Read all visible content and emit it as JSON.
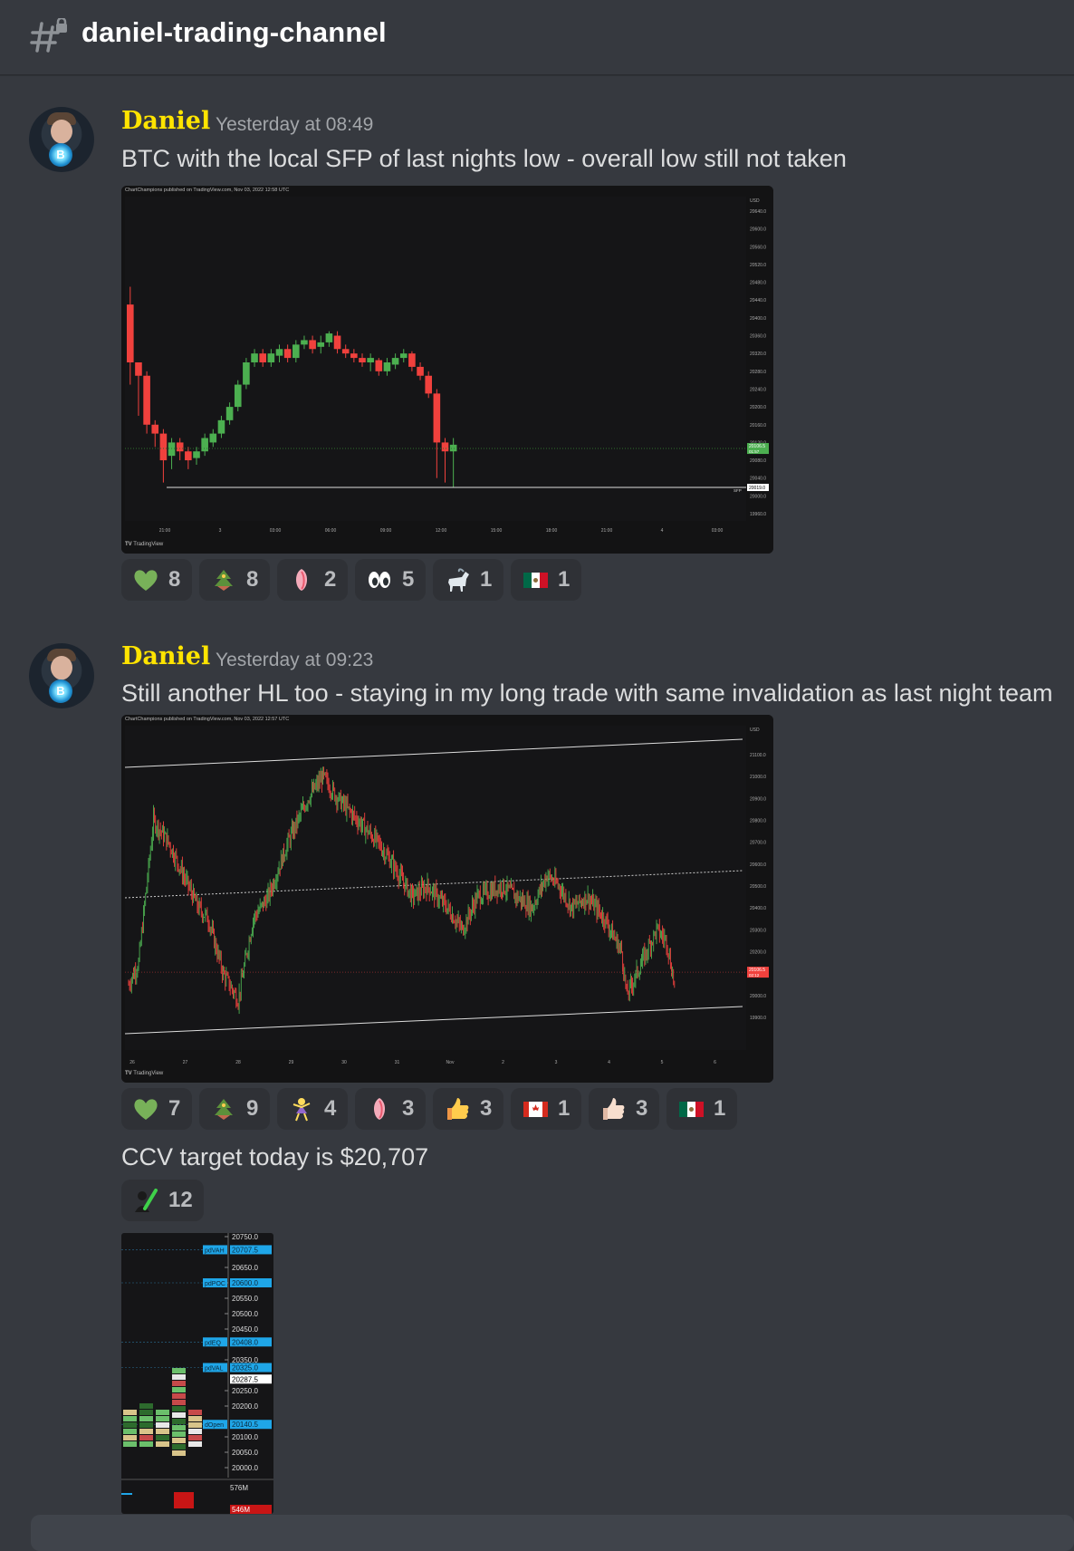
{
  "channel": {
    "name": "daniel-trading-channel",
    "icon": "locked-hash-icon"
  },
  "messages": [
    {
      "author": "Daniel",
      "timestamp": "Yesterday at 08:49",
      "text": "BTC with the local SFP of last nights low - overall low still not taken",
      "chart": {
        "attribution": "ChartChampions published on TradingView.com, Nov 03, 2022 12:58 UTC",
        "brand": "TradingView",
        "currency": "USD",
        "x_ticks": [
          "21:00",
          "3",
          "03:00",
          "06:00",
          "09:00",
          "12:00",
          "15:00",
          "18:00",
          "21:00",
          "4",
          "03:00"
        ],
        "y_ticks": [
          "20640.0",
          "20600.0",
          "20560.0",
          "20520.0",
          "20480.0",
          "20440.0",
          "20400.0",
          "20360.0",
          "20320.0",
          "20280.0",
          "20240.0",
          "20200.0",
          "20160.0",
          "20120.0",
          "20080.0",
          "20040.0",
          "20000.0",
          "19960.0"
        ],
        "price_label": "20106.5",
        "price_countdown": "01:57",
        "level_label": "20019.0",
        "level_tag": "SFP"
      },
      "reactions": [
        {
          "emoji": "green-heart-icon",
          "count": "8"
        },
        {
          "emoji": "tree-icon",
          "count": "8"
        },
        {
          "emoji": "pink-tulip-icon",
          "count": "2"
        },
        {
          "emoji": "eyes-icon",
          "count": "5"
        },
        {
          "emoji": "goat-icon",
          "count": "1"
        },
        {
          "emoji": "mexico-flag-icon",
          "count": "1"
        }
      ]
    },
    {
      "author": "Daniel",
      "timestamp": "Yesterday at 09:23",
      "text": "Still another HL too - staying in my long trade with same invalidation as last night team",
      "chart": {
        "attribution": "ChartChampions published on TradingView.com, Nov 03, 2022 12:57 UTC",
        "brand": "TradingView",
        "currency": "USD",
        "x_ticks": [
          "26",
          "27",
          "28",
          "29",
          "30",
          "31",
          "Nov",
          "2",
          "3",
          "4",
          "5",
          "6"
        ],
        "y_ticks": [
          "21100.0",
          "21000.0",
          "20900.0",
          "20800.0",
          "20700.0",
          "20600.0",
          "20500.0",
          "20400.0",
          "20300.0",
          "20200.0",
          "20100.0",
          "20000.0",
          "19900.0"
        ],
        "price_label": "20106.5",
        "price_countdown": "02:12"
      },
      "reactions": [
        {
          "emoji": "green-heart-icon",
          "count": "7"
        },
        {
          "emoji": "tree-icon",
          "count": "9"
        },
        {
          "emoji": "dancer-icon",
          "count": "4"
        },
        {
          "emoji": "pink-tulip-icon",
          "count": "3"
        },
        {
          "emoji": "thumbs-up-icon",
          "count": "3"
        },
        {
          "emoji": "canada-flag-icon",
          "count": "1"
        },
        {
          "emoji": "thumbs-up-light-icon",
          "count": "3"
        },
        {
          "emoji": "mexico-flag-icon",
          "count": "1"
        }
      ],
      "followup_text": "CCV target today is $20,707",
      "followup_reaction": {
        "emoji": "person-check-icon",
        "count": "12"
      },
      "ladder": {
        "levels": [
          "20750.0",
          "20650.0",
          "20600.0",
          "20550.0",
          "20500.0",
          "20450.0",
          "20350.0",
          "20250.0",
          "20200.0",
          "20100.0",
          "20050.0",
          "20000.0"
        ],
        "tags": [
          {
            "name": "pdVAH",
            "value": "20707.5"
          },
          {
            "name": "pdPOC",
            "value": "20600.0"
          },
          {
            "name": "pdEQ",
            "value": "20408.0"
          },
          {
            "name": "pdVAL",
            "value": "20325.0"
          },
          {
            "name": "dOpen",
            "value": "20140.5"
          }
        ],
        "current": "20287.5",
        "volume_top": "576M",
        "volume_bottom": "546M"
      }
    }
  ],
  "colors": {
    "author": "#ffe400",
    "bull": "#4caf50",
    "bear": "#f0413d",
    "background": "#36393f",
    "tag": "#1fa6e8"
  }
}
